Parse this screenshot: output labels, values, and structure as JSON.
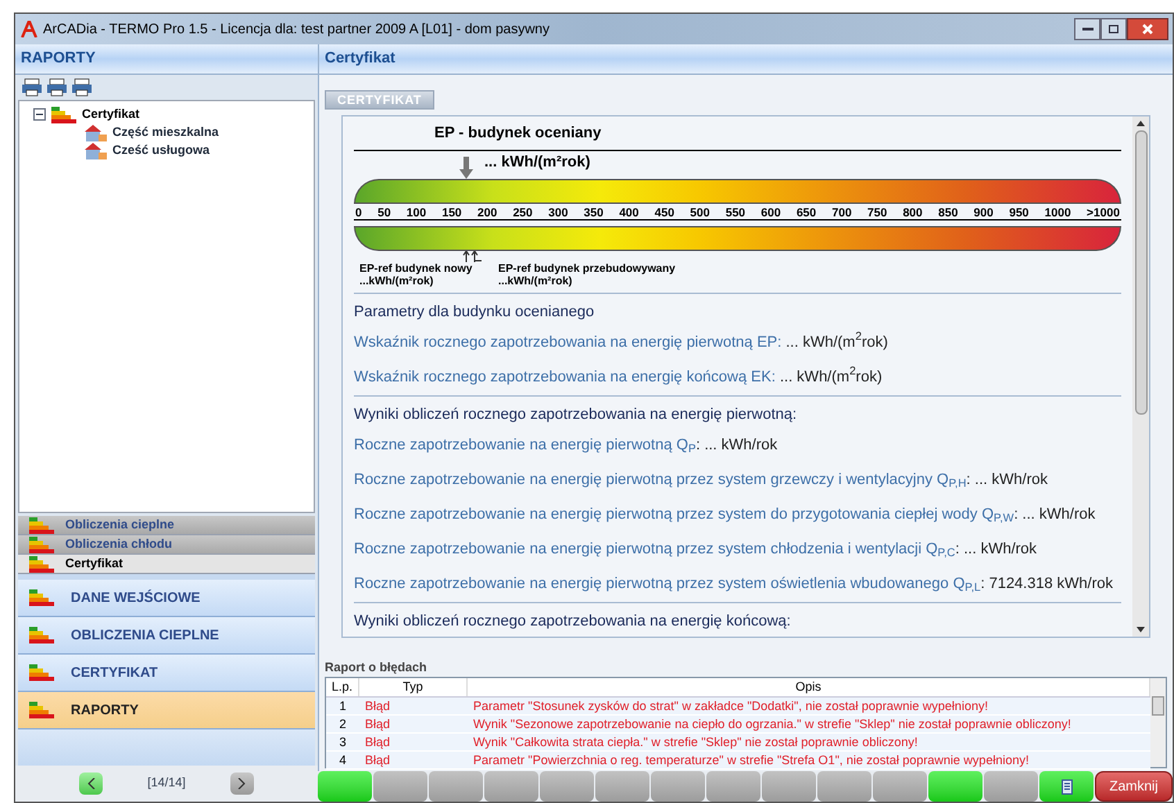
{
  "window": {
    "title": "ArCADia - TERMO Pro 1.5 - Licencja dla: test partner 2009 A [L01] - dom pasywny"
  },
  "sidebar": {
    "header": "RAPORTY",
    "tree": [
      {
        "label": "Certyfikat",
        "expanded": true,
        "children": [
          {
            "label": "Część mieszkalna"
          },
          {
            "label": "Cześć usługowa"
          }
        ]
      }
    ],
    "sections": [
      {
        "label": "Obliczenia cieplne",
        "kind": "sub",
        "selected": false
      },
      {
        "label": "Obliczenia chłodu",
        "kind": "sub",
        "selected": false
      },
      {
        "label": "Certyfikat",
        "kind": "sub",
        "selected": true
      },
      {
        "label": "DANE WEJŚCIOWE",
        "kind": "main",
        "selected": false
      },
      {
        "label": "OBLICZENIA CIEPLNE",
        "kind": "main",
        "selected": false
      },
      {
        "label": "CERTYFIKAT",
        "kind": "main",
        "selected": false
      },
      {
        "label": "RAPORTY",
        "kind": "main",
        "selected": true
      }
    ],
    "pager": "[14/14]"
  },
  "main": {
    "header": "Certyfikat",
    "tab": "CERTYFIKAT",
    "scale": {
      "title": "EP - budynek oceniany",
      "value": "... kWh/(m²rok)",
      "labels": [
        "0",
        "50",
        "100",
        "150",
        "200",
        "250",
        "300",
        "350",
        "400",
        "450",
        "500",
        "550",
        "600",
        "650",
        "700",
        "750",
        "800",
        "850",
        "900",
        "950",
        "1000",
        ">1000"
      ],
      "ref_new": {
        "label": "EP-ref budynek nowy",
        "value": "...kWh/(m²rok)"
      },
      "ref_rebuilt": {
        "label": "EP-ref budynek przebudowywany",
        "value": "...kWh/(m²rok)"
      }
    },
    "sections": [
      {
        "heading": "Parametry dla budynku ocenianego",
        "lines": [
          {
            "label": "Wskaźnik rocznego zapotrzebowania na energię pierwotną EP:",
            "value": " ... kWh/(m$^{2}$rok)"
          },
          {
            "label": "Wskaźnik rocznego zapotrzebowania na energię końcową EK:",
            "value": " ... kWh/(m$^{2}$rok)"
          }
        ]
      },
      {
        "heading": "Wyniki obliczeń rocznego zapotrzebowania na energię pierwotną:",
        "lines": [
          {
            "label": "Roczne zapotrzebowanie na energię pierwotną Q$_{P}$",
            "value": ": ... kWh/rok"
          },
          {
            "label": "Roczne zapotrzebowanie na energię pierwotną przez system grzewczy i wentylacyjny Q$_{P,H}$",
            "value": ": ... kWh/rok"
          },
          {
            "label": "Roczne zapotrzebowanie na energię pierwotną przez system do przygotowania ciepłej wody Q$_{P,W}$",
            "value": ": ... kWh/rok"
          },
          {
            "label": "Roczne zapotrzebowanie na energię pierwotną przez system chłodzenia i wentylacji Q$_{P,C}$",
            "value": ": ... kWh/rok"
          },
          {
            "label": "Roczne zapotrzebowanie na energię pierwotną przez system oświetlenia wbudowanego Q$_{P,L}$",
            "value": ": 7124.318 kWh/rok"
          }
        ]
      },
      {
        "heading": "Wyniki obliczeń rocznego zapotrzebowania na energię końcową:"
      }
    ]
  },
  "errors": {
    "title": "Raport o błędach",
    "columns": [
      "L.p.",
      "Typ",
      "Opis"
    ],
    "rows": [
      [
        "1",
        "Błąd",
        "Parametr \"Stosunek zysków do strat\" w zakładce \"Dodatki\", nie został poprawnie wypełniony!"
      ],
      [
        "2",
        "Błąd",
        "Wynik \"Sezonowe zapotrzebowanie na ciepło do ogrzania.\" w strefie \"Sklep\" nie został poprawnie obliczony!"
      ],
      [
        "3",
        "Błąd",
        "Wynik \"Całkowita strata ciepła.\" w strefie \"Sklep\" nie został poprawnie obliczony!"
      ],
      [
        "4",
        "Błąd",
        "Parametr \"Powierzchnia o reg. temperaturze\" w strefie \"Strefa O1\", nie został poprawnie wypełniony!"
      ]
    ]
  },
  "status_segments": [
    {
      "on": true
    },
    {
      "on": false
    },
    {
      "on": false
    },
    {
      "on": false
    },
    {
      "on": false
    },
    {
      "on": false
    },
    {
      "on": false
    },
    {
      "on": false
    },
    {
      "on": false
    },
    {
      "on": false
    },
    {
      "on": false
    },
    {
      "on": true
    },
    {
      "on": false
    },
    {
      "on": true,
      "kind": "icon"
    }
  ],
  "close_button": "Zamknij"
}
